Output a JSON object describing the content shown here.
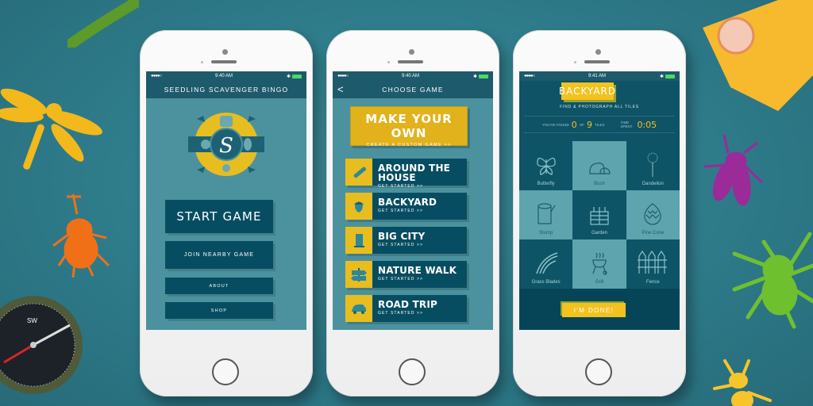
{
  "status_bar": {
    "signal": "●●●●○",
    "bluetooth": "✱"
  },
  "phones": [
    {
      "time": "9:40 AM",
      "title": "SEEDLING SCAVENGER BINGO",
      "logo": "seedling-crest-logo",
      "buttons": [
        "START GAME",
        "JOIN NEARBY GAME",
        "ABOUT",
        "SHOP"
      ]
    },
    {
      "time": "9:40 AM",
      "title": "CHOOSE GAME",
      "back": "<",
      "make_own": {
        "title": "MAKE YOUR OWN",
        "subtitle": "CREATE A CUSTOM GAME >>"
      },
      "categories": [
        {
          "name": "AROUND THE HOUSE",
          "cta": "GET STARTED >>",
          "icon": "comb-icon"
        },
        {
          "name": "BACKYARD",
          "cta": "GET STARTED >>",
          "icon": "acorn-icon"
        },
        {
          "name": "BIG CITY",
          "cta": "GET STARTED >>",
          "icon": "building-icon"
        },
        {
          "name": "NATURE WALK",
          "cta": "GET STARTED >>",
          "icon": "signpost-icon"
        },
        {
          "name": "ROAD TRIP",
          "cta": "GET STARTED >>",
          "icon": "car-icon"
        }
      ]
    },
    {
      "time": "9:41 AM",
      "title": "BACKYARD",
      "instruction": "FIND & PHOTOGRAPH ALL TILES",
      "found_label_pre": "YOU'VE FOUND",
      "found": "0",
      "of_label": "OF",
      "total": "9",
      "tiles_label": "TILES",
      "time_label": "TIME SPENT",
      "time_spent": "0:05",
      "tiles": [
        "Butterfly",
        "Bush",
        "Dandelion",
        "Stump",
        "Garden",
        "Pine Cone",
        "Grass Blades",
        "Grill",
        "Fence"
      ],
      "done_button": "I'M DONE!"
    }
  ],
  "colors": {
    "background": "#2e7b8a",
    "navy": "#074d62",
    "teal": "#4b929e",
    "yellow": "#e2b21c"
  }
}
